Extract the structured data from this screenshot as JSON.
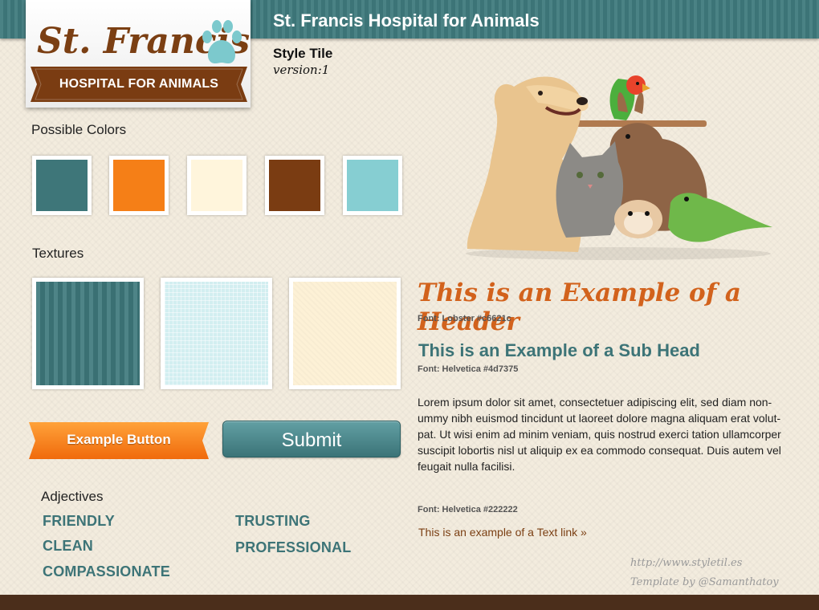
{
  "site_title": "St. Francis Hospital for Animals",
  "logo": {
    "name": "St. Francis",
    "tagline": "HOSPITAL FOR ANIMALS"
  },
  "tile": {
    "title": "Style Tile",
    "version": "version:1"
  },
  "colors_section": {
    "label": "Possible Colors",
    "swatches": [
      "#3e7679",
      "#f57f17",
      "#fff5dc",
      "#7a3c12",
      "#86ced2"
    ]
  },
  "textures_section": {
    "label": "Textures",
    "textures": [
      "teal-stripes",
      "light-blue-grid",
      "cream-weave"
    ]
  },
  "buttons": {
    "example": "Example Button",
    "submit": "Submit"
  },
  "adjectives": {
    "label": "Adjectives",
    "items": [
      "FRIENDLY",
      "CLEAN",
      "COMPASSIONATE",
      "TRUSTING",
      "PROFESSIONAL"
    ]
  },
  "typography": {
    "header": "This is an Example of a Header",
    "header_font": "Font: Lobster #c6621c",
    "subhead": "This is an Example of a Sub Head",
    "subhead_font": "Font: Helvetica  #4d7375",
    "body": "Lorem ipsum dolor sit amet, consectetuer adipiscing elit, sed diam non-ummy nibh euismod tincidunt ut laoreet dolore magna aliquam erat volut-pat. Ut wisi enim ad minim veniam, quis nostrud exerci tation ullamcorper suscipit lobortis nisl ut aliquip ex ea commodo consequat. Duis autem vel feugait nulla facilisi.",
    "body_font": "Font: Helvetica  #222222",
    "link": "This is an example of a Text link »"
  },
  "credits": {
    "url": "http://www.styletil.es",
    "author": "Template by @Samanthatoy"
  },
  "colors": {
    "teal": "#3f7a7d",
    "orange": "#f57f17",
    "brown": "#7b3f13",
    "header_orange": "#d2621c",
    "footer": "#4b2e1b"
  }
}
